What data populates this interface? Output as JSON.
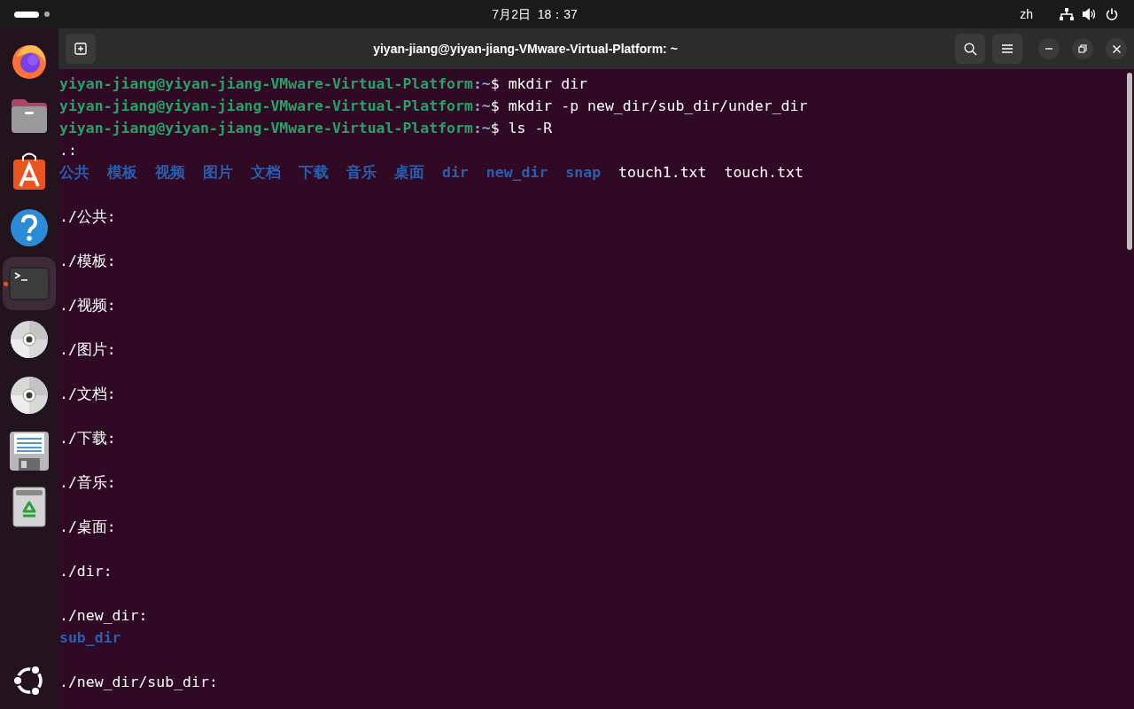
{
  "top_bar": {
    "clock": "7月2日  18：37",
    "language": "zh"
  },
  "dock": {
    "items": [
      {
        "kind": "firefox",
        "selected": false,
        "running": false
      },
      {
        "kind": "files",
        "selected": false,
        "running": false
      },
      {
        "kind": "store",
        "selected": false,
        "running": false
      },
      {
        "kind": "help",
        "selected": false,
        "running": false
      },
      {
        "kind": "terminal",
        "selected": true,
        "running": true
      },
      {
        "kind": "disc",
        "selected": false,
        "running": false
      },
      {
        "kind": "disc",
        "selected": false,
        "running": false
      },
      {
        "kind": "floppy",
        "selected": false,
        "running": false
      },
      {
        "kind": "trash",
        "selected": false,
        "running": false
      }
    ]
  },
  "window": {
    "title": "yiyan-jiang@yiyan-jiang-VMware-Virtual-Platform: ~"
  },
  "terminal": {
    "lines": [
      {
        "kind": "prompt",
        "user": "yiyan-jiang@yiyan-jiang-VMware-Virtual-Platform",
        "path": ":~",
        "command": "$ mkdir dir"
      },
      {
        "kind": "prompt",
        "user": "yiyan-jiang@yiyan-jiang-VMware-Virtual-Platform",
        "path": ":~",
        "command": "$ mkdir -p new_dir/sub_dir/under_dir"
      },
      {
        "kind": "prompt",
        "user": "yiyan-jiang@yiyan-jiang-VMware-Virtual-Platform",
        "path": ":~",
        "command": "$ ls -R"
      },
      {
        "kind": "text",
        "text": ".:"
      },
      {
        "kind": "listing",
        "items": [
          {
            "name": "公共",
            "kind": "dir"
          },
          {
            "name": "模板",
            "kind": "dir"
          },
          {
            "name": "视频",
            "kind": "dir"
          },
          {
            "name": "图片",
            "kind": "dir"
          },
          {
            "name": "文档",
            "kind": "dir"
          },
          {
            "name": "下载",
            "kind": "dir"
          },
          {
            "name": "音乐",
            "kind": "dir"
          },
          {
            "name": "桌面",
            "kind": "dir"
          },
          {
            "name": "dir",
            "kind": "dir"
          },
          {
            "name": "new_dir",
            "kind": "dir"
          },
          {
            "name": "snap",
            "kind": "dir"
          },
          {
            "name": "touch1.txt",
            "kind": "file"
          },
          {
            "name": "touch.txt",
            "kind": "file"
          }
        ]
      },
      {
        "kind": "blank"
      },
      {
        "kind": "text",
        "text": "./公共:"
      },
      {
        "kind": "blank"
      },
      {
        "kind": "text",
        "text": "./模板:"
      },
      {
        "kind": "blank"
      },
      {
        "kind": "text",
        "text": "./视频:"
      },
      {
        "kind": "blank"
      },
      {
        "kind": "text",
        "text": "./图片:"
      },
      {
        "kind": "blank"
      },
      {
        "kind": "text",
        "text": "./文档:"
      },
      {
        "kind": "blank"
      },
      {
        "kind": "text",
        "text": "./下载:"
      },
      {
        "kind": "blank"
      },
      {
        "kind": "text",
        "text": "./音乐:"
      },
      {
        "kind": "blank"
      },
      {
        "kind": "text",
        "text": "./桌面:"
      },
      {
        "kind": "blank"
      },
      {
        "kind": "text",
        "text": "./dir:"
      },
      {
        "kind": "blank"
      },
      {
        "kind": "text",
        "text": "./new_dir:"
      },
      {
        "kind": "listing",
        "items": [
          {
            "name": "sub_dir",
            "kind": "dir"
          }
        ]
      },
      {
        "kind": "blank"
      },
      {
        "kind": "text",
        "text": "./new_dir/sub_dir:"
      }
    ]
  }
}
